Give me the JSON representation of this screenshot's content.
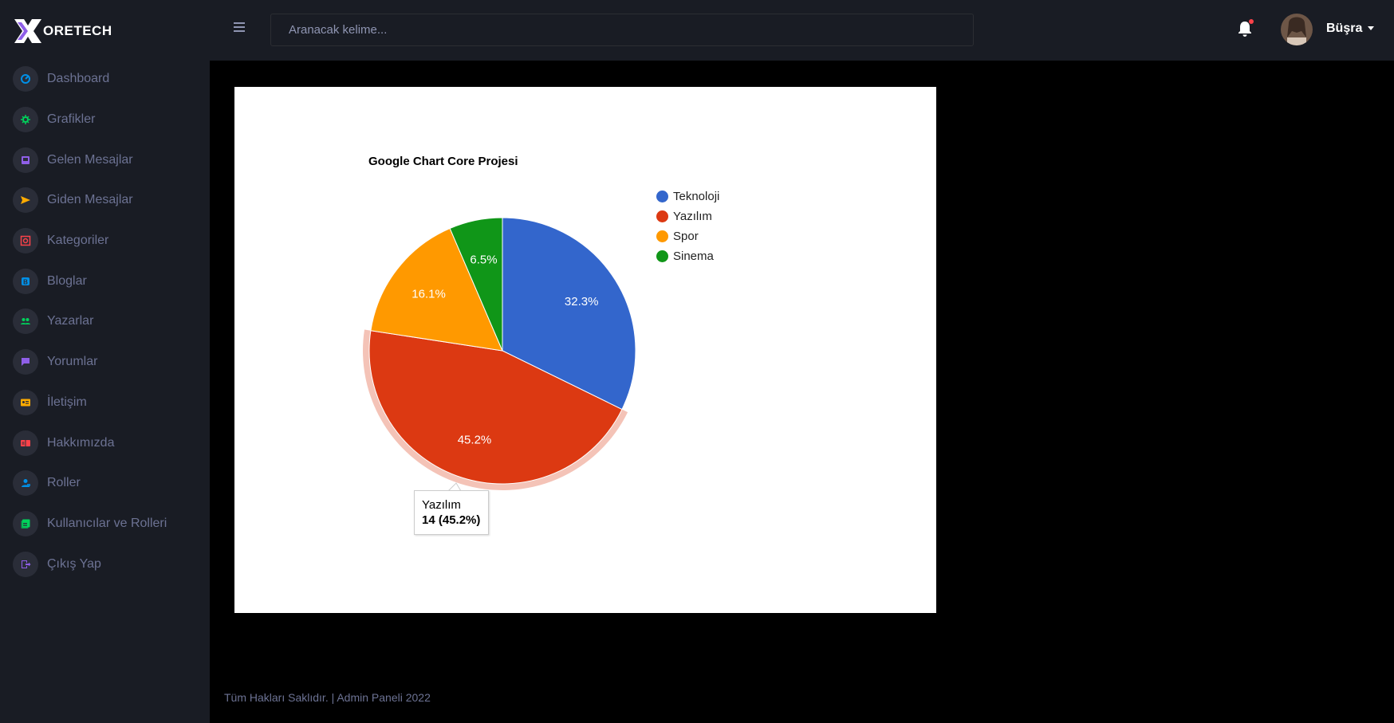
{
  "brand": {
    "name": "ORETECH",
    "logo_letter": "C"
  },
  "sidebar": {
    "items": [
      {
        "label": "Dashboard",
        "icon": "speedometer-icon",
        "color": "#0090e7"
      },
      {
        "label": "Grafikler",
        "icon": "chart-gear-icon",
        "color": "#00d25b"
      },
      {
        "label": "Gelen Mesajlar",
        "icon": "inbox-icon",
        "color": "#8f5fe8"
      },
      {
        "label": "Giden Mesajlar",
        "icon": "send-icon",
        "color": "#ffab00"
      },
      {
        "label": "Kategoriler",
        "icon": "category-icon",
        "color": "#fc424a"
      },
      {
        "label": "Bloglar",
        "icon": "blog-icon",
        "color": "#0090e7"
      },
      {
        "label": "Yazarlar",
        "icon": "people-icon",
        "color": "#00d25b"
      },
      {
        "label": "Yorumlar",
        "icon": "comment-icon",
        "color": "#8f5fe8"
      },
      {
        "label": "İletişim",
        "icon": "contact-card-icon",
        "color": "#ffab00"
      },
      {
        "label": "Hakkımızda",
        "icon": "book-icon",
        "color": "#fc424a"
      },
      {
        "label": "Roller",
        "icon": "user-role-icon",
        "color": "#0090e7"
      },
      {
        "label": "Kullanıcılar ve Rolleri",
        "icon": "user-list-icon",
        "color": "#00d25b"
      },
      {
        "label": "Çıkış Yap",
        "icon": "logout-icon",
        "color": "#8f5fe8"
      }
    ]
  },
  "topbar": {
    "search_placeholder": "Aranacak kelime...",
    "user_name": "Büşra"
  },
  "chart_data": {
    "type": "pie",
    "title": "Google Chart Core Projesi",
    "categories": [
      "Teknoloji",
      "Yazılım",
      "Spor",
      "Sinema"
    ],
    "values": [
      10,
      14,
      5,
      2
    ],
    "percent_labels": [
      "32.3%",
      "45.2%",
      "16.1%",
      "6.5%"
    ],
    "colors": [
      "#3366cc",
      "#dc3912",
      "#ff9900",
      "#109618"
    ],
    "legend": "right",
    "highlighted": {
      "label": "Yazılım",
      "value_text": "14 (45.2%)"
    }
  },
  "footer": {
    "text": "Tüm Hakları Saklıdır. | Admin Paneli 2022"
  }
}
